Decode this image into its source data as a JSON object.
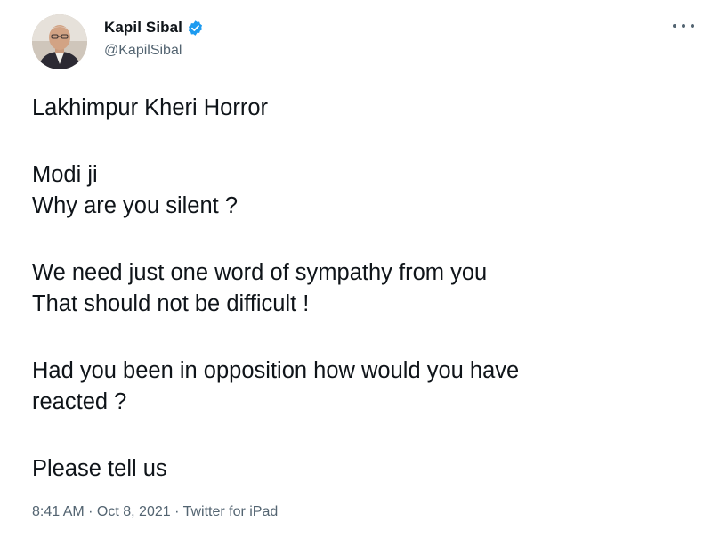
{
  "author": {
    "display_name": "Kapil Sibal",
    "handle": "@KapilSibal",
    "verified": true,
    "verified_color": "#1d9bf0"
  },
  "icons": {
    "avatar": "profile-photo",
    "verified": "verified-badge-icon",
    "more": "more-options-icon"
  },
  "tweet": {
    "paragraphs": [
      [
        "Lakhimpur Kheri Horror"
      ],
      [
        "Modi ji",
        "Why are you silent ?"
      ],
      [
        "We need just one word of sympathy from you",
        "That should not be difficult !"
      ],
      [
        "Had you been in opposition how would you have",
        "reacted ?"
      ],
      [
        "Please tell us"
      ]
    ]
  },
  "meta": {
    "text": "8:41 AM · Oct 8, 2021 · Twitter for iPad"
  }
}
